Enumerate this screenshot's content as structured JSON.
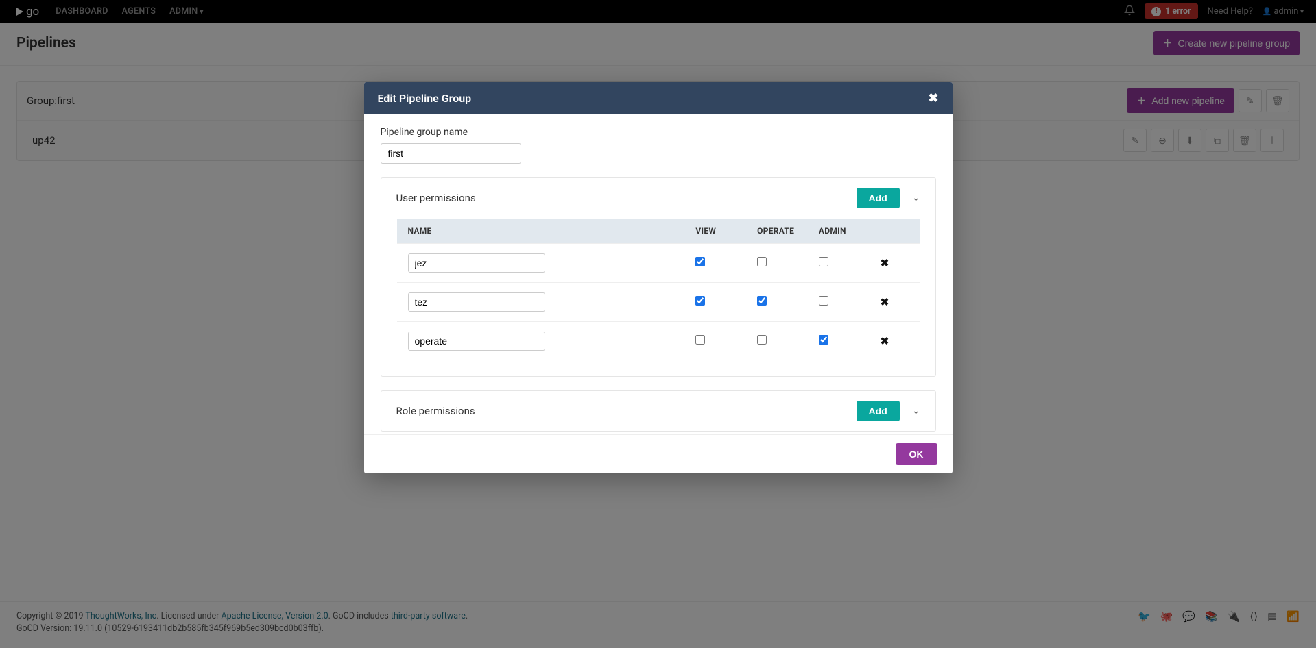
{
  "nav": {
    "brand": "go",
    "links": {
      "dashboard": "DASHBOARD",
      "agents": "AGENTS",
      "admin": "ADMIN"
    },
    "error_badge": "1 error",
    "need_help": "Need Help?",
    "user": "admin"
  },
  "page": {
    "title": "Pipelines",
    "create_group_btn": "Create new pipeline group"
  },
  "group": {
    "label_prefix": "Group: ",
    "name": "first",
    "add_pipeline_btn": "Add new pipeline",
    "pipelines": [
      {
        "name": "up42"
      }
    ]
  },
  "modal": {
    "title": "Edit Pipeline Group",
    "group_name_label": "Pipeline group name",
    "group_name_value": "first",
    "user_perms_title": "User permissions",
    "role_perms_title": "Role permissions",
    "add_btn": "Add",
    "ok_btn": "OK",
    "columns": {
      "name": "NAME",
      "view": "VIEW",
      "operate": "OPERATE",
      "admin": "ADMIN"
    },
    "users": [
      {
        "name": "jez",
        "view": true,
        "operate": false,
        "admin": false
      },
      {
        "name": "tez",
        "view": true,
        "operate": true,
        "admin": false
      },
      {
        "name": "operate",
        "view": false,
        "operate": false,
        "admin": true
      }
    ]
  },
  "footer": {
    "copyright_prefix": "Copyright © 2019 ",
    "thoughtworks": "ThoughtWorks, Inc",
    "licensed_under": ". Licensed under ",
    "apache": "Apache License, Version 2.0",
    "gocd_includes": ". GoCD includes ",
    "thirdparty": "third-party software",
    "period": ".",
    "version": "GoCD Version: 19.11.0 (10529-6193411db2b585fb345f969b5ed309bcd0b03ffb)."
  }
}
